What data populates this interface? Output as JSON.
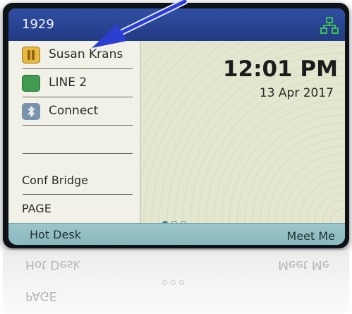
{
  "topbar": {
    "extension": "1929",
    "network_icon": "network-icon"
  },
  "lines": [
    {
      "label": "Susan Krans",
      "icon": "hold-icon",
      "state_color": "#e8b840"
    },
    {
      "label": "LINE 2",
      "icon": "line-idle-icon",
      "state_color": "#3f9c4f"
    },
    {
      "label": "Connect",
      "icon": "bluetooth-icon"
    },
    {
      "label": ""
    },
    {
      "label": "Conf Bridge"
    },
    {
      "label": "PAGE"
    }
  ],
  "clock": {
    "time": "12:01 PM",
    "date": "13 Apr 2017"
  },
  "pager": {
    "total": 3,
    "active_index": 0
  },
  "softkeys": {
    "left": "Hot Desk",
    "right": "Meet Me"
  },
  "annotation": {
    "color": "#2a3fd0",
    "icon": "arrow-icon"
  },
  "colors": {
    "header_bar": "#2a45a0",
    "softkey_bar": "#93c0c4",
    "screen_bg": "#e4e7cf"
  }
}
